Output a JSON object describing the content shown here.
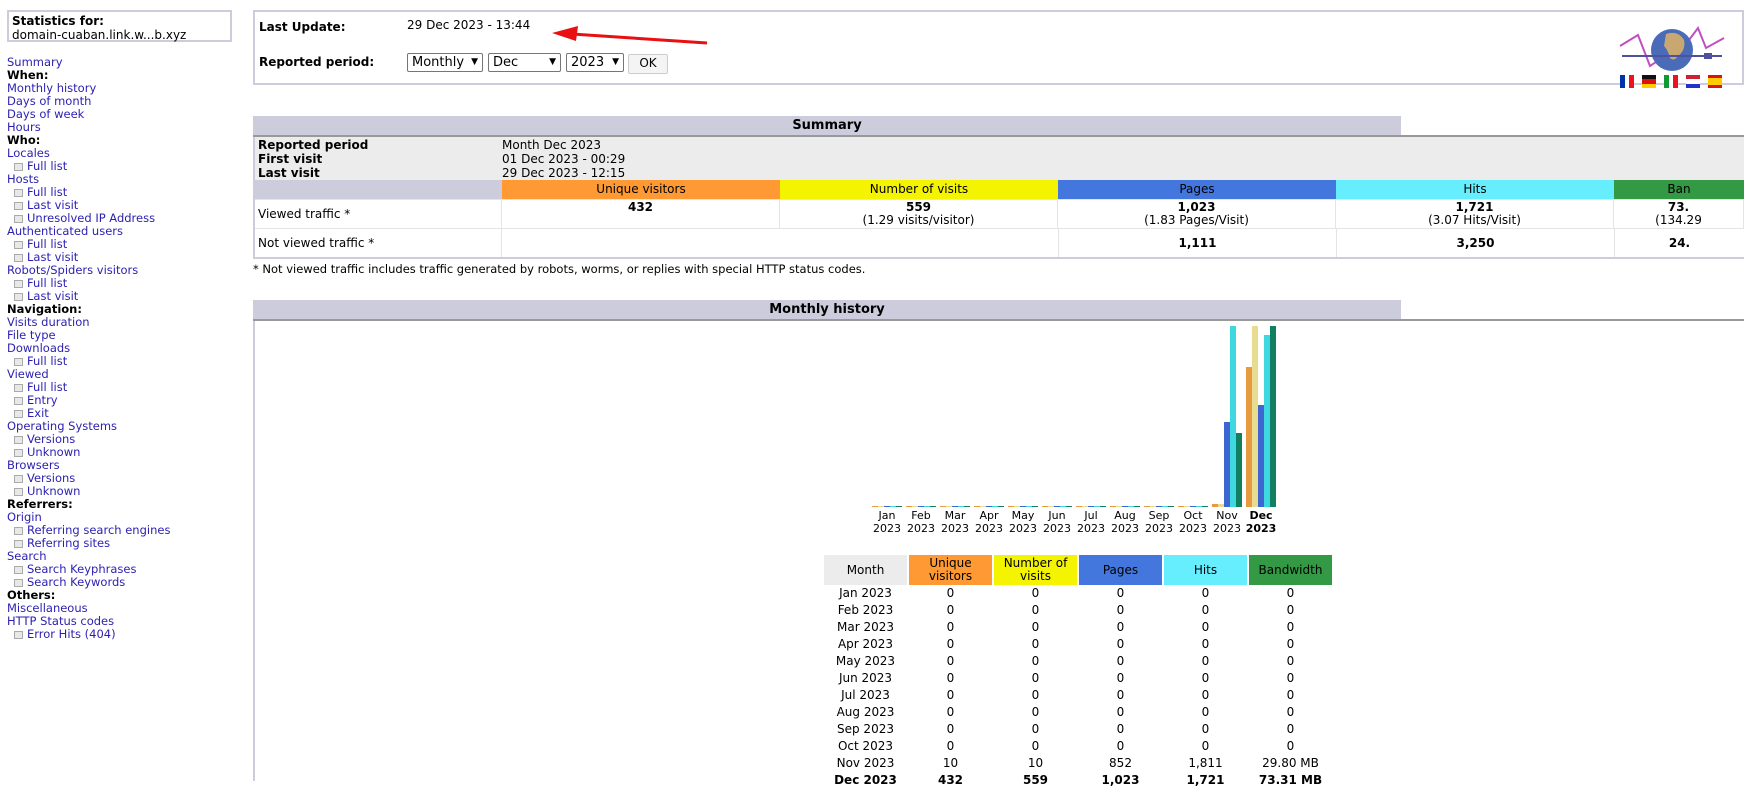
{
  "sidebar": {
    "stats_label": "Statistics for:",
    "site": "domain-cuaban.link.w...b.xyz",
    "menu": [
      {
        "type": "link",
        "label": "Summary"
      },
      {
        "type": "head",
        "label": "When:"
      },
      {
        "type": "link",
        "label": "Monthly history"
      },
      {
        "type": "link",
        "label": "Days of month"
      },
      {
        "type": "link",
        "label": "Days of week"
      },
      {
        "type": "link",
        "label": "Hours"
      },
      {
        "type": "head",
        "label": "Who:"
      },
      {
        "type": "link",
        "label": "Locales"
      },
      {
        "type": "sub",
        "label": "Full list"
      },
      {
        "type": "link",
        "label": "Hosts"
      },
      {
        "type": "sub",
        "label": "Full list"
      },
      {
        "type": "sub",
        "label": "Last visit"
      },
      {
        "type": "sub",
        "label": "Unresolved IP Address"
      },
      {
        "type": "link",
        "label": "Authenticated users"
      },
      {
        "type": "sub",
        "label": "Full list"
      },
      {
        "type": "sub",
        "label": "Last visit"
      },
      {
        "type": "link",
        "label": "Robots/Spiders visitors"
      },
      {
        "type": "sub",
        "label": "Full list"
      },
      {
        "type": "sub",
        "label": "Last visit"
      },
      {
        "type": "head",
        "label": "Navigation:"
      },
      {
        "type": "link",
        "label": "Visits duration"
      },
      {
        "type": "link",
        "label": "File type"
      },
      {
        "type": "link",
        "label": "Downloads"
      },
      {
        "type": "sub",
        "label": "Full list"
      },
      {
        "type": "link",
        "label": "Viewed"
      },
      {
        "type": "sub",
        "label": "Full list"
      },
      {
        "type": "sub",
        "label": "Entry"
      },
      {
        "type": "sub",
        "label": "Exit"
      },
      {
        "type": "link",
        "label": "Operating Systems"
      },
      {
        "type": "sub",
        "label": "Versions"
      },
      {
        "type": "sub",
        "label": "Unknown"
      },
      {
        "type": "link",
        "label": "Browsers"
      },
      {
        "type": "sub",
        "label": "Versions"
      },
      {
        "type": "sub",
        "label": "Unknown"
      },
      {
        "type": "head",
        "label": "Referrers:"
      },
      {
        "type": "link",
        "label": "Origin"
      },
      {
        "type": "sub",
        "label": "Referring search engines"
      },
      {
        "type": "sub",
        "label": "Referring sites"
      },
      {
        "type": "link",
        "label": "Search"
      },
      {
        "type": "sub",
        "label": "Search Keyphrases"
      },
      {
        "type": "sub",
        "label": "Search Keywords"
      },
      {
        "type": "head",
        "label": "Others:"
      },
      {
        "type": "link",
        "label": "Miscellaneous"
      },
      {
        "type": "link",
        "label": "HTTP Status codes"
      },
      {
        "type": "sub",
        "label": "Error Hits (404)"
      }
    ]
  },
  "header": {
    "last_update_label": "Last Update:",
    "last_update": "29 Dec 2023 - 13:44",
    "period_label": "Reported period:",
    "period_type": "Monthly",
    "month": "Dec",
    "year": "2023",
    "ok": "OK",
    "flags": [
      "fr",
      "de",
      "it",
      "nl",
      "es"
    ]
  },
  "summary": {
    "title": "Summary",
    "meta": [
      {
        "label": "Reported period",
        "value": "Month Dec 2023"
      },
      {
        "label": "First visit",
        "value": "01 Dec 2023 - 00:29"
      },
      {
        "label": "Last visit",
        "value": "29 Dec 2023 - 12:15"
      }
    ],
    "columns": [
      "Unique visitors",
      "Number of visits",
      "Pages",
      "Hits",
      "Ban"
    ],
    "viewed_label": "Viewed traffic *",
    "viewed": [
      {
        "main": "432",
        "sub": ""
      },
      {
        "main": "559",
        "sub": "(1.29 visits/visitor)"
      },
      {
        "main": "1,023",
        "sub": "(1.83 Pages/Visit)"
      },
      {
        "main": "1,721",
        "sub": "(3.07 Hits/Visit)"
      },
      {
        "main": "73.",
        "sub": "(134.29"
      }
    ],
    "not_viewed_label": "Not viewed traffic *",
    "not_viewed": [
      "",
      "",
      "1,111",
      "3,250",
      "24."
    ],
    "note": "* Not viewed traffic includes traffic generated by robots, worms, or replies with special HTTP status codes."
  },
  "monthly": {
    "title": "Monthly history",
    "colors": {
      "unique": "#FF9933",
      "visits": "#F4F400",
      "pages": "#4477DD",
      "hits": "#66EEFF",
      "bandwidth": "#339944"
    },
    "columns": [
      "Month",
      "Unique visitors",
      "Number of visits",
      "Pages",
      "Hits",
      "Bandwidth"
    ],
    "rows": [
      [
        "Jan 2023",
        "0",
        "0",
        "0",
        "0",
        "0"
      ],
      [
        "Feb 2023",
        "0",
        "0",
        "0",
        "0",
        "0"
      ],
      [
        "Mar 2023",
        "0",
        "0",
        "0",
        "0",
        "0"
      ],
      [
        "Apr 2023",
        "0",
        "0",
        "0",
        "0",
        "0"
      ],
      [
        "May 2023",
        "0",
        "0",
        "0",
        "0",
        "0"
      ],
      [
        "Jun 2023",
        "0",
        "0",
        "0",
        "0",
        "0"
      ],
      [
        "Jul 2023",
        "0",
        "0",
        "0",
        "0",
        "0"
      ],
      [
        "Aug 2023",
        "0",
        "0",
        "0",
        "0",
        "0"
      ],
      [
        "Sep 2023",
        "0",
        "0",
        "0",
        "0",
        "0"
      ],
      [
        "Oct 2023",
        "0",
        "0",
        "0",
        "0",
        "0"
      ],
      [
        "Nov 2023",
        "10",
        "10",
        "852",
        "1,811",
        "29.80 MB"
      ],
      [
        "Dec 2023",
        "432",
        "559",
        "1,023",
        "1,721",
        "73.31 MB"
      ]
    ]
  },
  "chart_data": {
    "type": "bar",
    "categories": [
      "Jan",
      "Feb",
      "Mar",
      "Apr",
      "May",
      "Jun",
      "Jul",
      "Aug",
      "Sep",
      "Oct",
      "Nov",
      "Dec"
    ],
    "year_labels": [
      "2023",
      "2023",
      "2023",
      "2023",
      "2023",
      "2023",
      "2023",
      "2023",
      "2023",
      "2023",
      "2023",
      "2023"
    ],
    "highlight": "Dec",
    "series": [
      {
        "key": "unique",
        "values": [
          0,
          0,
          0,
          0,
          0,
          0,
          0,
          0,
          0,
          0,
          10,
          432
        ]
      },
      {
        "key": "visits",
        "values": [
          0,
          0,
          0,
          0,
          0,
          0,
          0,
          0,
          0,
          0,
          10,
          559
        ]
      },
      {
        "key": "pages",
        "values": [
          0,
          0,
          0,
          0,
          0,
          0,
          0,
          0,
          0,
          0,
          852,
          1023
        ]
      },
      {
        "key": "hits",
        "values": [
          0,
          0,
          0,
          0,
          0,
          0,
          0,
          0,
          0,
          0,
          1811,
          1721
        ]
      },
      {
        "key": "bandwidth",
        "unit": "MB",
        "values": [
          0,
          0,
          0,
          0,
          0,
          0,
          0,
          0,
          0,
          0,
          29.8,
          73.31
        ]
      }
    ]
  }
}
